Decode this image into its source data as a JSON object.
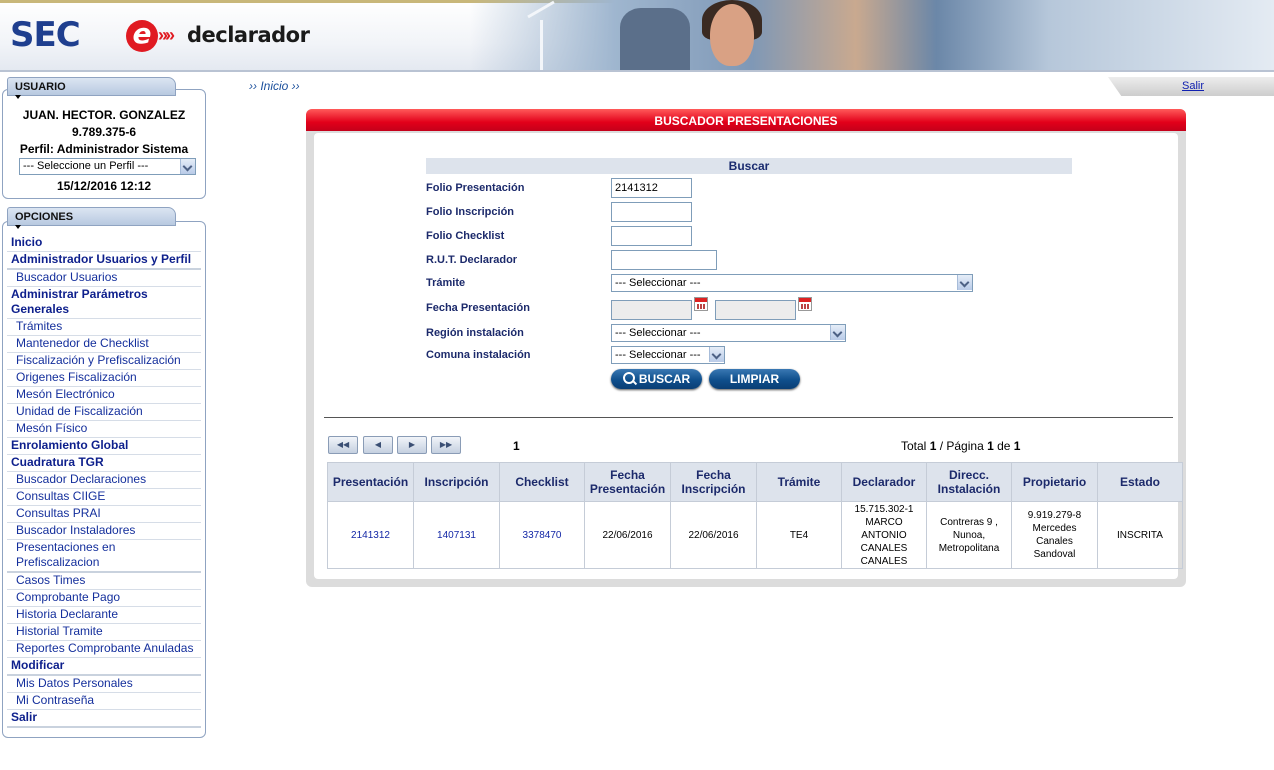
{
  "header": {
    "logo_sec": "SEC",
    "logo_e": "e",
    "logo_arrows": "»»",
    "logo_declarador": "declarador"
  },
  "usuario": {
    "tab_label": "USUARIO",
    "name": "JUAN. HECTOR. GONZALEZ",
    "rut": "9.789.375-6",
    "perfil": "Perfil: Administrador Sistema",
    "perfil_select": "--- Seleccione un Perfil ---",
    "datetime": "15/12/2016 12:12"
  },
  "opciones": {
    "tab_label": "OPCIONES",
    "items": [
      {
        "label": "Inicio",
        "type": "hd"
      },
      {
        "label": "Administrador Usuarios y Perfil",
        "type": "hd"
      },
      {
        "label": "Buscador Usuarios",
        "type": "sub"
      },
      {
        "label": "Administrar Parámetros Generales",
        "type": "hd"
      },
      {
        "label": "Trámites",
        "type": "sub"
      },
      {
        "label": "Mantenedor de Checklist",
        "type": "sub"
      },
      {
        "label": "Fiscalización y Prefiscalización",
        "type": "sub"
      },
      {
        "label": "Origenes Fiscalización",
        "type": "sub"
      },
      {
        "label": "Mesón Electrónico",
        "type": "sub"
      },
      {
        "label": "Unidad de Fiscalización",
        "type": "sub"
      },
      {
        "label": "Mesón Físico",
        "type": "sub"
      },
      {
        "label": "Enrolamiento Global",
        "type": "hd"
      },
      {
        "label": "Cuadratura TGR",
        "type": "hd"
      },
      {
        "label": "Buscador Declaraciones",
        "type": "sub"
      },
      {
        "label": "Consultas CIIGE",
        "type": "sub"
      },
      {
        "label": "Consultas PRAI",
        "type": "sub"
      },
      {
        "label": "Buscador Instaladores",
        "type": "sub"
      },
      {
        "label": "Presentaciones en Prefiscalizacion",
        "type": "sub"
      },
      {
        "label": "Casos Times",
        "type": "sub"
      },
      {
        "label": "Comprobante Pago",
        "type": "sub"
      },
      {
        "label": "Historia Declarante",
        "type": "sub"
      },
      {
        "label": "Historial Tramite",
        "type": "sub"
      },
      {
        "label": "Reportes Comprobante Anuladas",
        "type": "sub"
      },
      {
        "label": "Modificar",
        "type": "hd"
      },
      {
        "label": "Mis Datos Personales",
        "type": "sub"
      },
      {
        "label": "Mi Contraseña",
        "type": "sub"
      },
      {
        "label": "Salir",
        "type": "hd"
      }
    ]
  },
  "breadcrumb": "›› Inicio ››",
  "salir": "Salir",
  "panel": {
    "title": "BUSCADOR PRESENTACIONES",
    "buscar_header": "Buscar",
    "labels": {
      "folio_presentacion": "Folio Presentación",
      "folio_inscripcion": "Folio Inscripción",
      "folio_checklist": "Folio Checklist",
      "rut_declarador": "R.U.T. Declarador",
      "tramite": "Trámite",
      "fecha_presentacion": "Fecha Presentación",
      "region": "Región instalación",
      "comuna": "Comuna instalación"
    },
    "values": {
      "folio_presentacion": "2141312",
      "folio_inscripcion": "",
      "folio_checklist": "",
      "rut_declarador": "",
      "tramite": "--- Seleccionar ---",
      "region": "--- Seleccionar ---",
      "comuna": "--- Seleccionar ---"
    },
    "buttons": {
      "buscar": "BUSCAR",
      "limpiar": "LIMPIAR"
    }
  },
  "pagination": {
    "current_page": "1",
    "total_prefix": "Total ",
    "total": "1",
    "pagina_label": " / Página ",
    "page": "1",
    "de_label": " de ",
    "pages": "1"
  },
  "table": {
    "headers": [
      "Presentación",
      "Inscripción",
      "Checklist",
      "Fecha Presentación",
      "Fecha Inscripción",
      "Trámite",
      "Declarador",
      "Direcc. Instalación",
      "Propietario",
      "Estado"
    ],
    "rows": [
      [
        "2141312",
        "1407131",
        "3378470",
        "22/06/2016",
        "22/06/2016",
        "TE4",
        "15.715.302-1 MARCO ANTONIO CANALES CANALES",
        "Contreras 9 , Nunoa, Metropolitana",
        "9.919.279-8 Mercedes Canales Sandoval",
        "INSCRITA"
      ]
    ]
  }
}
